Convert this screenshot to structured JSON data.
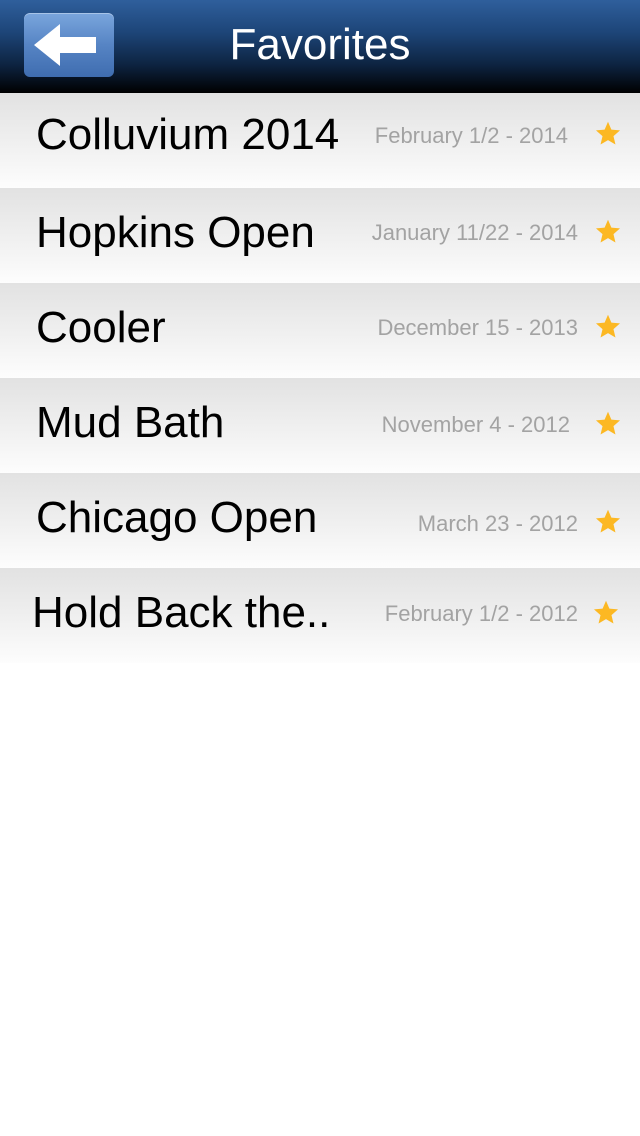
{
  "header": {
    "title": "Favorites",
    "back_icon": "back-arrow-icon"
  },
  "favorites": [
    {
      "name": "Colluvium 2014",
      "date": "February 1/2 - 2014",
      "icon": "star-icon"
    },
    {
      "name": "Hopkins Open",
      "date": "January 11/22 - 2014",
      "icon": "star-icon"
    },
    {
      "name": "Cooler",
      "date": "December 15 - 2013",
      "icon": "star-icon"
    },
    {
      "name": "Mud Bath",
      "date": "November 4 - 2012",
      "icon": "star-icon"
    },
    {
      "name": "Chicago Open",
      "date": "March 23 - 2012",
      "icon": "star-icon"
    },
    {
      "name": "Hold Back the..",
      "date": "February 1/2 - 2012",
      "icon": "star-icon"
    }
  ],
  "colors": {
    "star": "#fcb823",
    "date_text": "#a3a3a3",
    "navbar_top": "#2f5f9c",
    "back_button": "#5684c4"
  }
}
